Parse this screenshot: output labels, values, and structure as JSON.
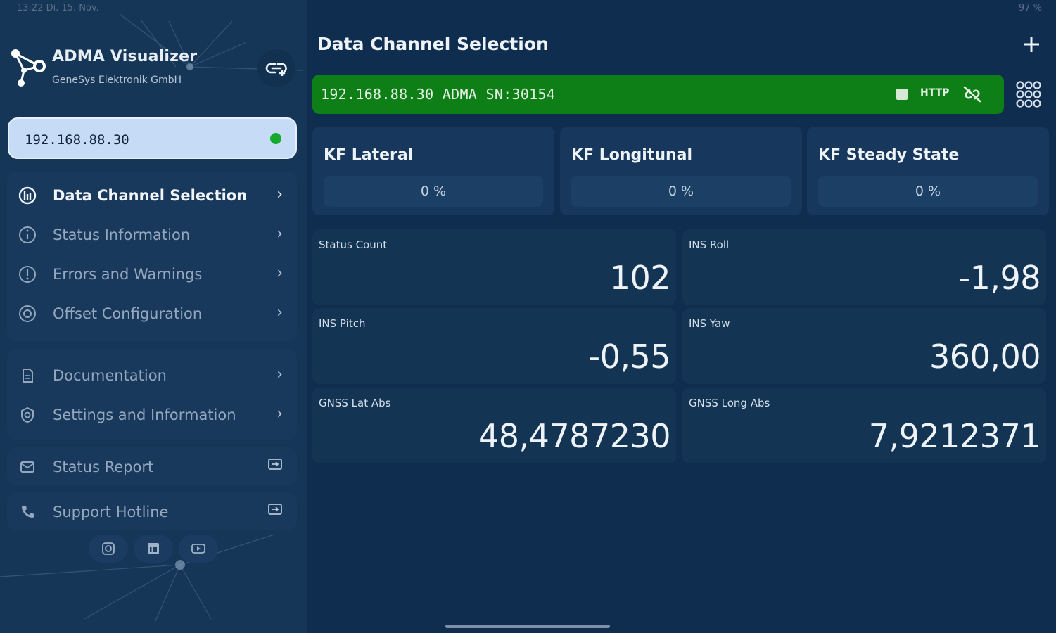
{
  "status_bar": {
    "time": "13:22 Di. 15. Nov.",
    "right": "97 %"
  },
  "app": {
    "title": "ADMA Visualizer",
    "subtitle": "GeneSys Elektronik GmbH"
  },
  "device": {
    "ip": "192.168.88.30",
    "status_color": "#17a82e"
  },
  "sidebar": {
    "group1": [
      {
        "label": "Data Channel Selection",
        "icon": "channels-icon",
        "active": true
      },
      {
        "label": "Status Information",
        "icon": "info-icon",
        "active": false
      },
      {
        "label": "Errors and Warnings",
        "icon": "warning-icon",
        "active": false
      },
      {
        "label": "Offset Configuration",
        "icon": "target-icon",
        "active": false
      }
    ],
    "group2": [
      {
        "label": "Documentation",
        "icon": "document-icon"
      },
      {
        "label": "Settings and Information",
        "icon": "settings-icon"
      }
    ],
    "status_report": "Status Report",
    "support_hotline": "Support Hotline"
  },
  "main": {
    "title": "Data Channel Selection",
    "connection": {
      "text": "192.168.88.30  ADMA SN:30154",
      "protocol": "HTTP",
      "color": "#0e7f17"
    },
    "kf_cards": [
      {
        "title": "KF Lateral",
        "value": "0 %"
      },
      {
        "title": "KF Longitunal",
        "value": "0 %"
      },
      {
        "title": "KF Steady State",
        "value": "0 %"
      }
    ],
    "values": [
      {
        "label": "Status Count",
        "value": "102"
      },
      {
        "label": "INS Roll",
        "value": "-1,98"
      },
      {
        "label": "INS Pitch",
        "value": "-0,55"
      },
      {
        "label": "INS Yaw",
        "value": "360,00"
      },
      {
        "label": "GNSS Lat Abs",
        "value": "48,4787230"
      },
      {
        "label": "GNSS Long Abs",
        "value": "7,9212371"
      }
    ]
  }
}
